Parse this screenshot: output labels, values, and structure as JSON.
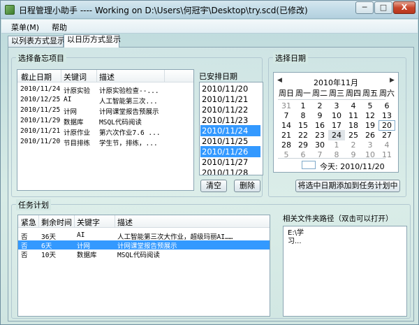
{
  "window": {
    "title": "日程管理小助手 ----  Working on D:\\Users\\何冠宇\\Desktop\\try.scd(已修改)",
    "minimize_label": "─",
    "maximize_label": "□",
    "close_label": "X"
  },
  "menu": {
    "items": [
      {
        "label": "菜单(M)"
      },
      {
        "label": "帮助"
      }
    ]
  },
  "tabs": [
    {
      "label": "以列表方式显示"
    },
    {
      "label": "以日历方式显示"
    }
  ],
  "select_memo": {
    "title": "选择备忘项目",
    "columns": [
      "截止日期",
      "关键词",
      "描述"
    ],
    "rows": [
      {
        "date": "2010/11/24",
        "keyword": "计原实验",
        "desc": "计原实验检查--..."
      },
      {
        "date": "2010/12/25",
        "keyword": "AI",
        "desc": "人工智能第三次..."
      },
      {
        "date": "2010/11/25",
        "keyword": "计网",
        "desc": "计网课堂报告预展示"
      },
      {
        "date": "2010/11/29",
        "keyword": "数据库",
        "desc": "MSQL代码阅读"
      },
      {
        "date": "2010/11/21",
        "keyword": "计原作业",
        "desc": "第六次作业7.6 ..."
      },
      {
        "date": "2010/11/20",
        "keyword": "节目排练",
        "desc": "学生节，排练，..."
      }
    ]
  },
  "scheduled": {
    "title": "已安排日期",
    "dates": [
      "2010/11/20",
      "2010/11/21",
      "2010/11/22",
      "2010/11/23",
      "2010/11/24",
      "2010/11/25",
      "2010/11/26",
      "2010/11/27",
      "2010/11/28"
    ],
    "clear_label": "清空",
    "delete_label": "删除"
  },
  "select_date": {
    "title": "选择日期",
    "month": "2010年11月",
    "weekdays": [
      "周日",
      "周一",
      "周二",
      "周三",
      "周四",
      "周五",
      "周六"
    ],
    "days": [
      [
        "31",
        "1",
        "2",
        "3",
        "4",
        "5",
        "6"
      ],
      [
        "7",
        "8",
        "9",
        "10",
        "11",
        "12",
        "13"
      ],
      [
        "14",
        "15",
        "16",
        "17",
        "18",
        "19",
        "20"
      ],
      [
        "21",
        "22",
        "23",
        "24",
        "25",
        "26",
        "27"
      ],
      [
        "28",
        "29",
        "30",
        "1",
        "2",
        "3",
        "4"
      ],
      [
        "5",
        "6",
        "7",
        "8",
        "9",
        "10",
        "11"
      ]
    ],
    "today_label": "今天: 2010/11/20",
    "add_button": "将选中日期添加到任务计划中"
  },
  "task_plan": {
    "title": "任务计划",
    "columns": [
      "紧急",
      "剩余时间",
      "关键字",
      "描述"
    ],
    "rows": [
      {
        "urgent": "否",
        "remaining": "36天",
        "keyword": "AI",
        "desc": "人工智能第三次大作业，超级玛丽AI……"
      },
      {
        "urgent": "否",
        "remaining": "6天",
        "keyword": "计网",
        "desc": "计网课堂报告预展示"
      },
      {
        "urgent": "否",
        "remaining": "10天",
        "keyword": "数据库",
        "desc": "MSQL代码阅读"
      }
    ]
  },
  "file_path": {
    "title": "相关文件夹路径（双击可以打开）",
    "line1": "E:\\学",
    "line2": "习..."
  },
  "colors": {
    "selection": "#3399ff"
  }
}
